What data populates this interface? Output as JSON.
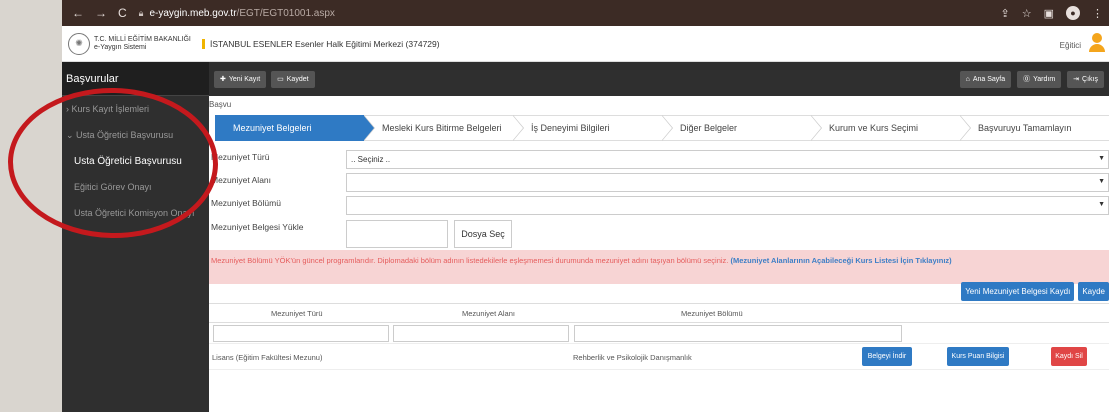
{
  "browser": {
    "url_host": "e-yaygin.meb.gov.tr",
    "url_path": "/EGT/EGT01001.aspx"
  },
  "header": {
    "logo_line1": "T.C. MİLLİ EĞİTİM BAKANLIĞI",
    "logo_line2": "e-Yaygın Sistemi",
    "institution": "İSTANBUL ESENLER Esenler Halk Eğitimi Merkezi (374729)",
    "role": "Eğitici"
  },
  "sidebar": {
    "title": "Başvurular",
    "items": [
      {
        "label": "Kurs Kayıt İşlemleri"
      },
      {
        "label": "Usta Öğretici Başvurusu"
      },
      {
        "label": "Usta Öğretici Başvurusu"
      },
      {
        "label": "Eğitici Görev Onayı"
      },
      {
        "label": "Usta Öğretici Komisyon Onayı"
      }
    ]
  },
  "toolbar": {
    "new_label": "Yeni Kayıt",
    "save_label": "Kaydet",
    "home_label": "Ana Sayfa",
    "help_label": "Yardım",
    "exit_label": "Çıkış"
  },
  "main": {
    "crumb": "Başvu",
    "steps": [
      {
        "label": "Mezuniyet Belgeleri"
      },
      {
        "label": "Mesleki Kurs Bitirme Belgeleri"
      },
      {
        "label": "İş Deneyimi Bilgileri"
      },
      {
        "label": "Diğer Belgeler"
      },
      {
        "label": "Kurum ve Kurs Seçimi"
      },
      {
        "label": "Başvuruyu Tamamlayın"
      }
    ],
    "fields": {
      "type_label": "Mezuniyet Türü",
      "type_value": ".. Seçiniz ..",
      "area_label": "Mezuniyet Alanı",
      "dept_label": "Mezuniyet Bölümü",
      "upload_label": "Mezuniyet Belgesi Yükle",
      "file_button": "Dosya Seç"
    },
    "alert_text": "Mezuniyet Bölümü YÖK'ün güncel programlarıdır. Diplomadaki bölüm adının listedekilerle eşleşmemesi durumunda mezuniyet adını taşıyan bölümü seçiniz.",
    "alert_link": "(Mezuniyet Alanlarının Açabileceği Kurs Listesi İçin Tıklayınız)",
    "buttons": {
      "new_cert": "Yeni Mezuniyet Belgesi Kaydı",
      "save": "Kayde"
    },
    "table": {
      "headers": [
        "Mezuniyet Türü",
        "Mezuniyet Alanı",
        "Mezuniyet Bölümü"
      ],
      "rows": [
        {
          "type": "Lisans (Eğitim Fakültesi Mezunu)",
          "area": "",
          "dept": "Rehberlik ve Psikolojik Danışmanlık",
          "btn_download": "Belgeyi İndir",
          "btn_points": "Kurs Puan Bilgisi",
          "btn_delete": "Kaydı Sil"
        }
      ]
    }
  },
  "colors": {
    "primary": "#2f7ac4",
    "danger": "#e04646",
    "sidebar_bg": "#2f2f2f",
    "alert_bg": "#f7d4d4",
    "annotation": "#c4191d"
  }
}
